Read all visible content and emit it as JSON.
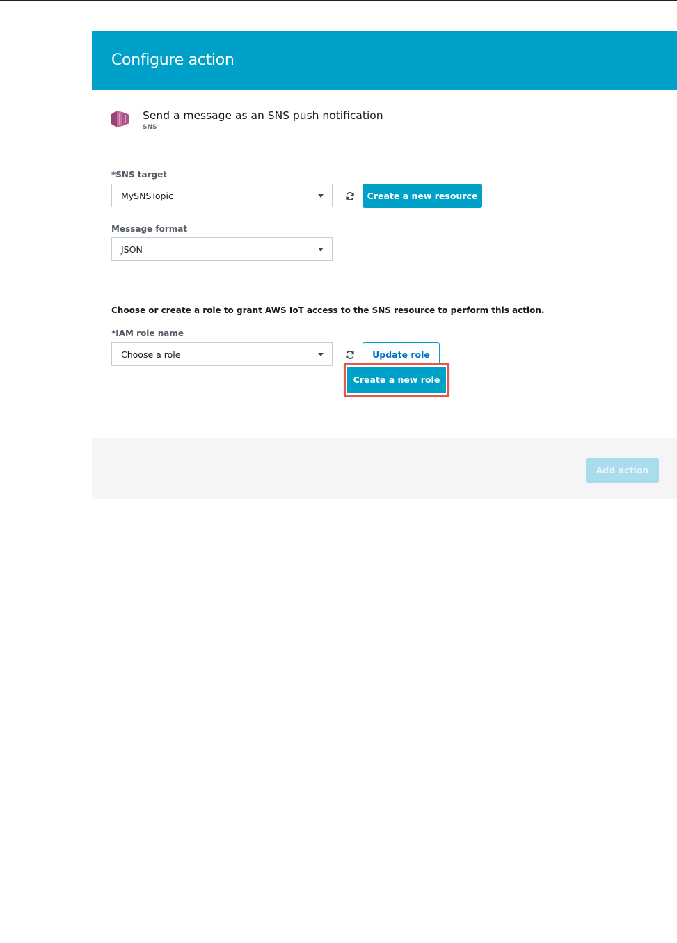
{
  "dialog": {
    "title": "Configure action"
  },
  "action": {
    "title": "Send a message as an SNS push notification",
    "subtitle": "SNS",
    "icon": "sns-icon"
  },
  "sns_target": {
    "label": "*SNS target",
    "value": "MySNSTopic",
    "create_button": "Create a new resource"
  },
  "message_format": {
    "label": "Message format",
    "value": "JSON"
  },
  "role": {
    "description": "Choose or create a role to grant AWS IoT access to the SNS resource to perform this action.",
    "label": "*IAM role name",
    "value": "Choose a role",
    "update_button": "Update role",
    "create_button": "Create a new role"
  },
  "footer": {
    "add_action_button": "Add action"
  },
  "colors": {
    "header": "#00a1c9",
    "primary": "#00a1c9",
    "highlight": "#e8574a",
    "disabled": "#a9dcec",
    "sns_icon": "#b0548a"
  }
}
